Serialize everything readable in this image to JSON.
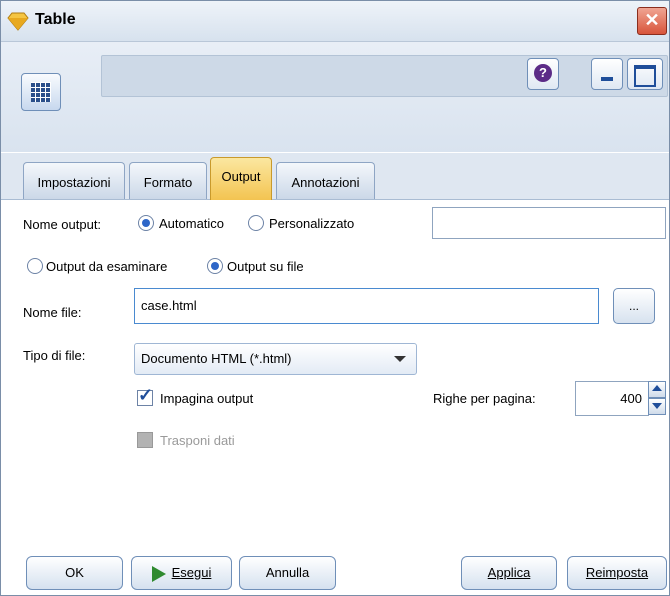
{
  "window": {
    "title": "Table",
    "close_glyph": "✕"
  },
  "header": {
    "help_glyph": "?"
  },
  "tabs": [
    {
      "label": "Impostazioni"
    },
    {
      "label": "Formato"
    },
    {
      "label": "Output"
    },
    {
      "label": "Annotazioni"
    }
  ],
  "output": {
    "name_label": "Nome output:",
    "auto_label": "Automatico",
    "custom_label": "Personalizzato",
    "custom_value": "",
    "examine_label": "Output da esaminare",
    "to_file_label": "Output su file",
    "file_name_label": "Nome file:",
    "file_name_value": "case.html",
    "browse_label": "...",
    "file_type_label": "Tipo di file:",
    "file_type_value": "Documento HTML (*.html)",
    "paginate_label": "Impagina output",
    "rows_label": "Righe per pagina:",
    "rows_value": "400",
    "transpose_label": "Trasponi dati"
  },
  "buttons": {
    "ok": "OK",
    "run": "Esegui",
    "cancel": "Annulla",
    "apply": "Applica",
    "reset": "Reimposta"
  },
  "colors": {
    "active_tab": "#f3c451",
    "accent": "#2d66c8",
    "play": "#2f8a2f",
    "close": "#d8543a"
  }
}
